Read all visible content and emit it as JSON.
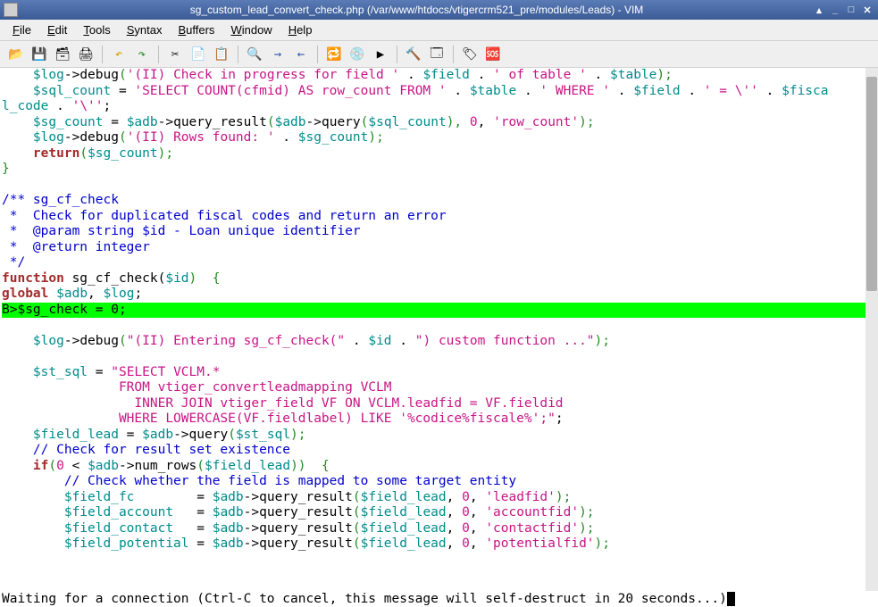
{
  "title": "sg_custom_lead_convert_check.php (/var/www/htdocs/vtigercrm521_pre/modules/Leads) - VIM",
  "menus": {
    "file": "File",
    "edit": "Edit",
    "tools": "Tools",
    "syntax": "Syntax",
    "buffers": "Buffers",
    "window": "Window",
    "help": "Help"
  },
  "toolbar": {
    "open": "📂",
    "save": "💾",
    "saveall": "🗃",
    "print": "🖨",
    "undo": "↶",
    "redo": "↷",
    "cut": "✂",
    "copy": "📄",
    "paste": "📋",
    "find": "🔍",
    "next": "→",
    "prev": "←",
    "replace": "🔁",
    "session": "💿",
    "script": "▶",
    "make": "🔨",
    "shell": "🗔",
    "tags": "🏷",
    "help2": "🆘"
  },
  "code": {
    "l1a": "    $log",
    "l1b": "->",
    "l1c": "debug",
    "l1d": "(",
    "l1e": "'(II) Check in progress for field '",
    "l1f": " . ",
    "l1g": "$field",
    "l1h": " . ",
    "l1i": "' of table '",
    "l1j": " . ",
    "l1k": "$table",
    "l1l": ");",
    "l2a": "    $sql_count",
    "l2b": " = ",
    "l2c": "'SELECT COUNT(cfmid) AS row_count FROM '",
    "l2d": " . ",
    "l2e": "$table",
    "l2f": " . ",
    "l2g": "' WHERE '",
    "l2h": " . ",
    "l2i": "$field",
    "l2j": " . ",
    "l2k": "' = \\''",
    "l2l": " . ",
    "l2m": "$fisca",
    "l3a": "l_code",
    "l3b": " . ",
    "l3c": "'\\''",
    "l3d": ";",
    "l4a": "    $sg_count",
    "l4b": " = ",
    "l4c": "$adb",
    "l4d": "->",
    "l4e": "query_result",
    "l4f": "(",
    "l4g": "$adb",
    "l4h": "->",
    "l4i": "query",
    "l4j": "(",
    "l4k": "$sql_count",
    "l4l": "), ",
    "l4m": "0",
    "l4n": ", ",
    "l4o": "'row_count'",
    "l4p": ");",
    "l5a": "    $log",
    "l5b": "->",
    "l5c": "debug",
    "l5d": "(",
    "l5e": "'(II) Rows found: '",
    "l5f": " . ",
    "l5g": "$sg_count",
    "l5h": ");",
    "l6a": "    return",
    "l6b": "(",
    "l6c": "$sg_count",
    "l6d": ");",
    "l7": "}",
    "l8": "",
    "l9": "/** sg_cf_check",
    "l10": " *  Check for duplicated fiscal codes and return an error",
    "l11": " *  @param string $id - Loan unique identifier",
    "l12": " *  @return integer",
    "l13": " */",
    "l14a": "function",
    "l14b": " sg_cf_check(",
    "l14c": "$id",
    "l14d": ")  {",
    "l15a": "global",
    "l15b": " ",
    "l15c": "$adb",
    "l15d": ", ",
    "l15e": "$log",
    "l15f": ";",
    "l16": "B>$sg_check = 0;",
    "l17": "",
    "l18a": "    $log",
    "l18b": "->",
    "l18c": "debug",
    "l18d": "(",
    "l18e": "\"(II) Entering sg_cf_check(\"",
    "l18f": " . ",
    "l18g": "$id",
    "l18h": " . ",
    "l18i": "\") custom function ...\"",
    "l18j": ");",
    "l19": "",
    "l20a": "    $st_sql",
    "l20b": " = ",
    "l20c": "\"SELECT VCLM.*",
    "l21": "               FROM vtiger_convertleadmapping VCLM",
    "l22": "                 INNER JOIN vtiger_field VF ON VCLM.leadfid = VF.fieldid",
    "l23a": "               WHERE LOWERCASE(VF.fieldlabel) LIKE '%codice%fiscale%';\"",
    "l23b": ";",
    "l24a": "    $field_lead",
    "l24b": " = ",
    "l24c": "$adb",
    "l24d": "->",
    "l24e": "query",
    "l24f": "(",
    "l24g": "$st_sql",
    "l24h": ");",
    "l25": "    // Check for result set existence",
    "l26a": "    if",
    "l26b": "(",
    "l26c": "0",
    "l26d": " < ",
    "l26e": "$adb",
    "l26f": "->",
    "l26g": "num_rows",
    "l26h": "(",
    "l26i": "$field_lead",
    "l26j": "))  {",
    "l27": "        // Check whether the field is mapped to some target entity",
    "l28a": "        $field_fc",
    "l28b": "        = ",
    "l28c": "$adb",
    "l28d": "->",
    "l28e": "query_result",
    "l28f": "(",
    "l28g": "$field_lead",
    "l28h": ", ",
    "l28i": "0",
    "l28j": ", ",
    "l28k": "'leadfid'",
    "l28l": ");",
    "l29a": "        $field_account",
    "l29b": "   = ",
    "l29c": "$adb",
    "l29d": "->",
    "l29e": "query_result",
    "l29f": "(",
    "l29g": "$field_lead",
    "l29h": ", ",
    "l29i": "0",
    "l29j": ", ",
    "l29k": "'accountfid'",
    "l29l": ");",
    "l30a": "        $field_contact",
    "l30b": "   = ",
    "l30c": "$adb",
    "l30d": "->",
    "l30e": "query_result",
    "l30f": "(",
    "l30g": "$field_lead",
    "l30h": ", ",
    "l30i": "0",
    "l30j": ", ",
    "l30k": "'contactfid'",
    "l30l": ");",
    "l31a": "        $field_potential",
    "l31b": " = ",
    "l31c": "$adb",
    "l31d": "->",
    "l31e": "query_result",
    "l31f": "(",
    "l31g": "$field_lead",
    "l31h": ", ",
    "l31i": "0",
    "l31j": ", ",
    "l31k": "'potentialfid'",
    "l31l": ");"
  },
  "status": "Waiting for a connection (Ctrl-C to cancel, this message will self-destruct in  20  seconds...)"
}
